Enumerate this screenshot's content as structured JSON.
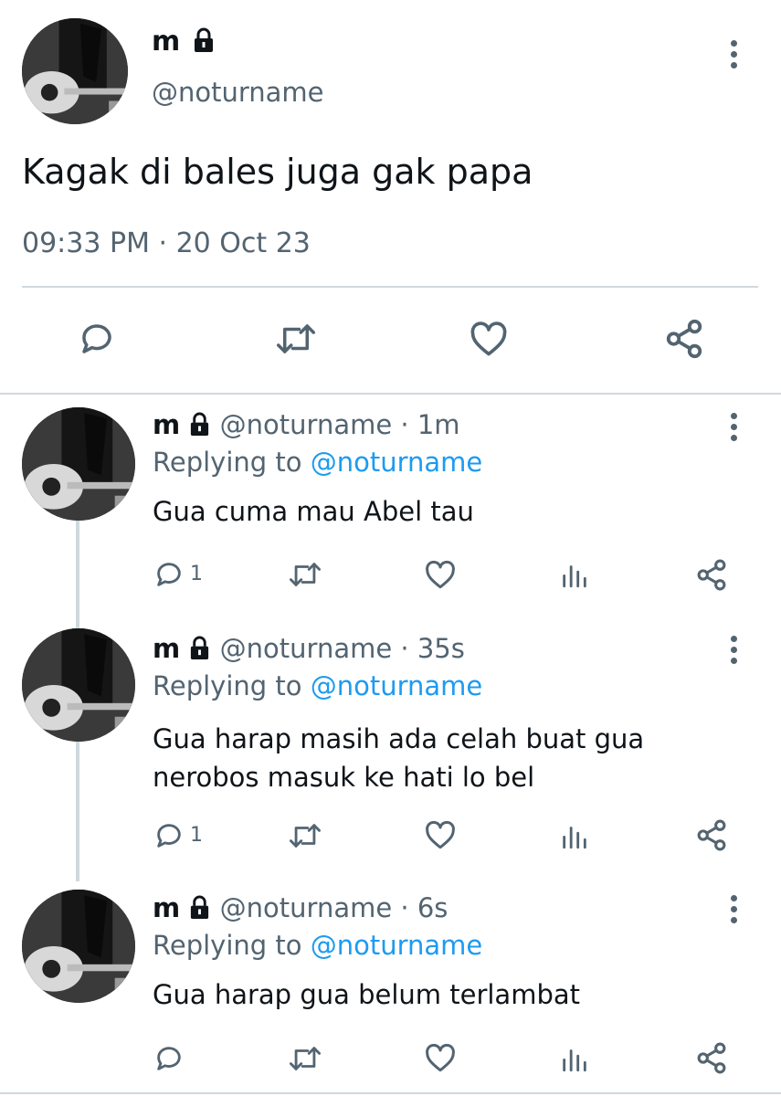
{
  "main_tweet": {
    "display_name": "m",
    "handle": "@noturname",
    "text": "Kagak di bales juga gak papa",
    "timestamp": "09:33 PM · 20 Oct 23",
    "actions": [
      "reply-icon",
      "retweet-icon",
      "like-icon",
      "share-icon"
    ]
  },
  "replies": [
    {
      "display_name": "m",
      "handle": "@noturname",
      "time": "· 1m",
      "replying_prefix": "Replying to",
      "replying_handle": "@noturname",
      "text_lines": [
        "Gua cuma mau Abel tau"
      ],
      "reply_count": "1"
    },
    {
      "display_name": "m",
      "handle": "@noturname",
      "time": "· 35s",
      "replying_prefix": "Replying to",
      "replying_handle": "@noturname",
      "text_lines": [
        "Gua harap masih ada celah buat gua",
        "nerobos masuk ke hati lo bel"
      ],
      "reply_count": "1"
    },
    {
      "display_name": "m",
      "handle": "@noturname",
      "time": "· 6s",
      "replying_prefix": "Replying to",
      "replying_handle": "@noturname",
      "text_lines": [
        "Gua harap gua belum terlambat"
      ],
      "reply_count": ""
    }
  ],
  "colors": {
    "text": "#0f1419",
    "secondary": "#536471",
    "link": "#1d9bf0",
    "divider": "#cfd9de"
  }
}
